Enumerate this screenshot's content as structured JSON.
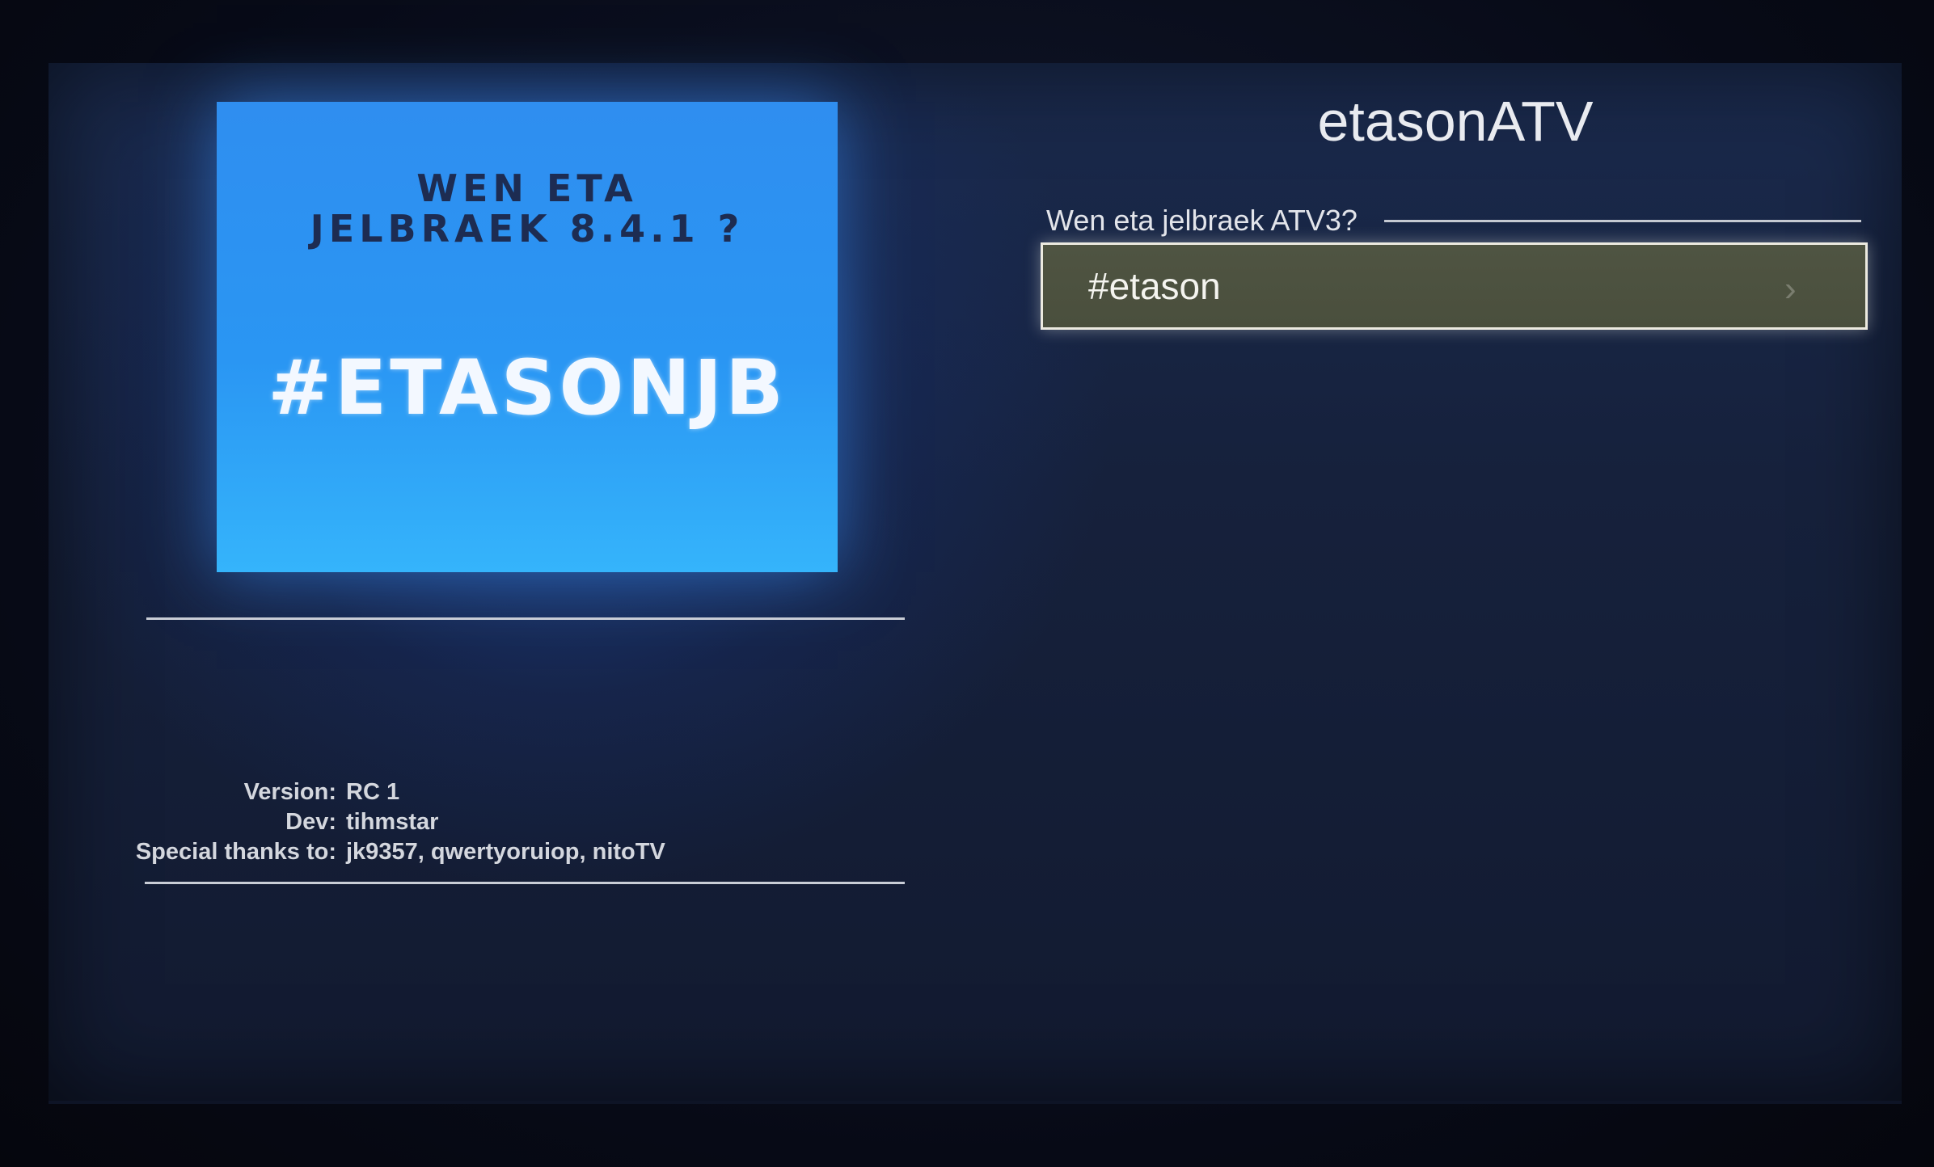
{
  "app": {
    "title": "etasonATV"
  },
  "artwork": {
    "line1": "WEN ETA",
    "line2": "JELBRAEK 8.4.1 ?",
    "main": "#ETASONJB"
  },
  "menu": {
    "section_header": "Wen eta jelbraek ATV3?",
    "items": [
      {
        "label": "#etason",
        "icon": "chevron-right-icon",
        "selected": true
      }
    ]
  },
  "info": {
    "version_label": "Version:",
    "version_value": "RC 1",
    "dev_label": "Dev:",
    "dev_value": "tihmstar",
    "thanks_label": "Special thanks to:",
    "thanks_value": "jk9357, qwertyoruiop, nitoTV"
  },
  "colors": {
    "accent_selection": "#4f5442",
    "artwork_blue": "#2f8ef0",
    "background": "#16213c"
  }
}
